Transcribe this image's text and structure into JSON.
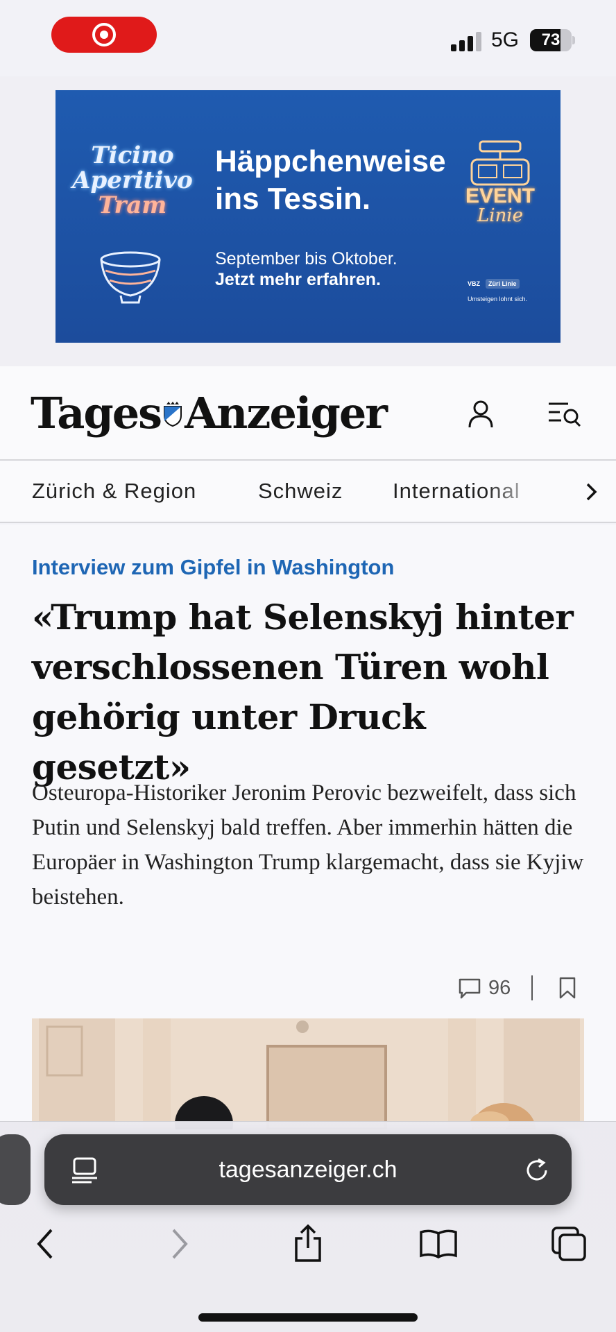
{
  "status_bar": {
    "network": "5G",
    "battery_level": "73",
    "battery_fraction": 0.73,
    "signal_bars_active": 3,
    "signal_bars_total": 4,
    "recording_color": "#e01a1a"
  },
  "ad": {
    "script_line1": "Ticino",
    "script_line2": "Aperitivo",
    "script_line3": "Tram",
    "headline_line1": "Häppchenweise",
    "headline_line2": "ins Tessin.",
    "sub_line1": "September bis Oktober.",
    "sub_line2": "Jetzt mehr erfahren.",
    "event_line1": "EVENT",
    "event_line2": "Linie",
    "logo1": "VBZ",
    "logo2": "Züri Linie",
    "small_text": "Umsteigen lohnt sich.",
    "bg_color": "#1f5bb0"
  },
  "header": {
    "logo_left": "Tages",
    "logo_right": "Anzeiger",
    "profile_icon": "user-icon",
    "menu_icon": "menu-search-icon"
  },
  "nav": {
    "items": [
      {
        "label": "Zürich & Region"
      },
      {
        "label": "Schweiz"
      },
      {
        "label": "International"
      }
    ],
    "more_icon": "chevron-right-icon"
  },
  "article": {
    "kicker": "Interview zum Gipfel in Washington",
    "kicker_color": "#1e66b4",
    "headline": "«Trump hat Selenskyj hinter verschlossenen Türen wohl gehörig unter Druck gesetzt»",
    "lead": "Osteuropa-Historiker Jeronim Perovic bezweifelt, dass sich Putin und Selenskyj bald treffen. Aber immerhin hätten die Europäer in Washington Trump klargemacht, dass sie Kyjiw beistehen.",
    "comments": "96",
    "comment_icon": "comment-icon",
    "bookmark_icon": "bookmark-icon"
  },
  "browser": {
    "url": "tagesanzeiger.ch",
    "reader_icon": "page-menu-icon",
    "reload_icon": "reload-icon",
    "toolbar": [
      "back-icon",
      "forward-icon",
      "share-icon",
      "bookmarks-icon",
      "tabs-icon"
    ]
  }
}
